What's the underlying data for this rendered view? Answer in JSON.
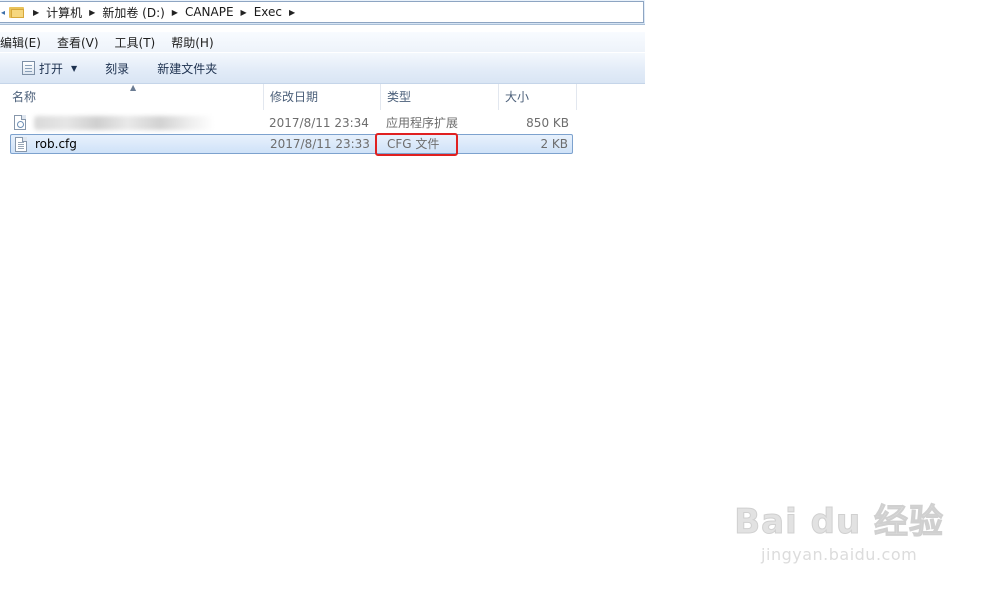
{
  "breadcrumb": {
    "items": [
      "计算机",
      "新加卷 (D:)",
      "CANAPE",
      "Exec"
    ]
  },
  "menubar": {
    "items": [
      "编辑(E)",
      "查看(V)",
      "工具(T)",
      "帮助(H)"
    ]
  },
  "toolbar": {
    "open_label": "打开",
    "burn_label": "刻录",
    "new_folder_label": "新建文件夹"
  },
  "columns": {
    "name": "名称",
    "date": "修改日期",
    "type": "类型",
    "size": "大小"
  },
  "files": [
    {
      "name": "",
      "date": "2017/8/11 23:34",
      "type": "应用程序扩展",
      "size": "850 KB",
      "icon": "dll-file-icon",
      "name_obscured": true
    },
    {
      "name": "rob.cfg",
      "date": "2017/8/11 23:33",
      "type": "CFG 文件",
      "size": "2 KB",
      "icon": "cfg-file-icon",
      "selected": true
    }
  ],
  "annotation": {
    "color": "#e02020",
    "target": "CFG 文件"
  },
  "watermark": {
    "logo": "Bai du 经验",
    "url": "jingyan.baidu.com"
  }
}
